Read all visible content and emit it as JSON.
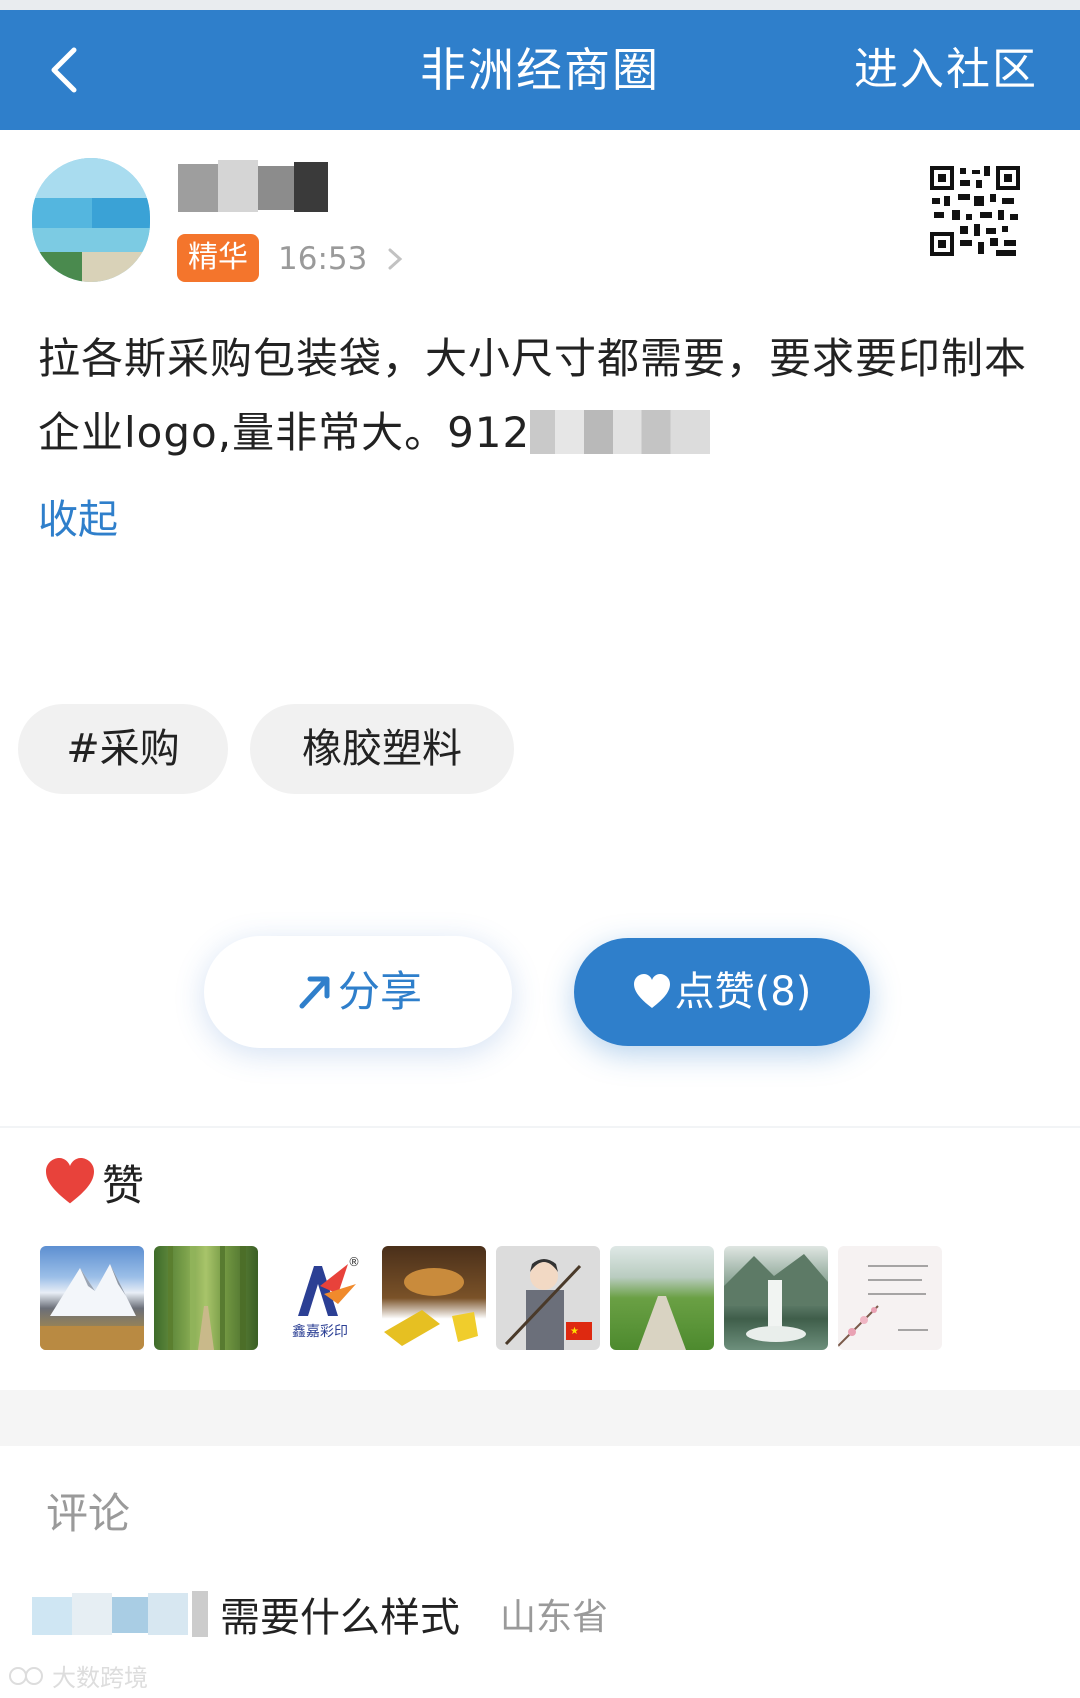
{
  "nav": {
    "title": "非洲经商圈",
    "action": "进入社区",
    "bg_color": "#2f7fcb"
  },
  "post": {
    "badge": "精华",
    "time": "16:53",
    "text": "拉各斯采购包装袋，大小尺寸都需要，要求要印制本企业logo,量非常大。912",
    "collapse_label": "收起",
    "tags": [
      "#采购",
      "橡胶塑料"
    ]
  },
  "actions": {
    "share_label": "分享",
    "like_label": "点赞(8)"
  },
  "likes": {
    "title": "赞",
    "users": [
      "mountain-snow",
      "bamboo-path",
      "xinjia-logo",
      "gold-dishes",
      "anime-avatar",
      "country-road",
      "waterfall-painting",
      "plum-blossom-calligraphy"
    ],
    "logo_text": "鑫嘉彩印"
  },
  "comments": {
    "title": "评论",
    "items": [
      {
        "text": "需要什么样式",
        "location": "山东省"
      }
    ]
  },
  "watermark": "大数跨境"
}
